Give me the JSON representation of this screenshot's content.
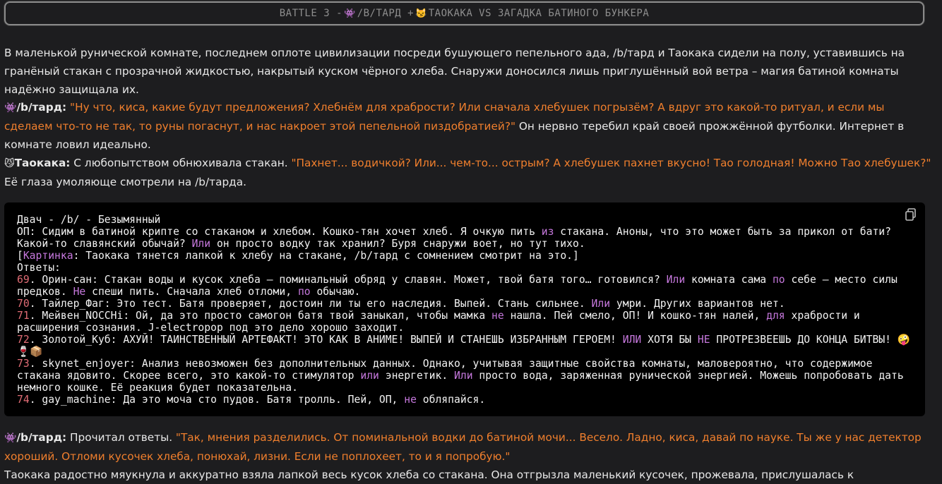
{
  "title": {
    "part1": "BATTLE 3 - ",
    "emoji1": "👾",
    "part2": "/B/ТАРД + ",
    "emoji2": "😼",
    "part3": "ТАОКАКА VS ЗАГАДКА БАТИНОГО БУНКЕРА"
  },
  "intro": "В маленькой рунической комнате, последнем оплоте цивилизации посреди бушующего пепельного ада, /b/тард и Таокака сидели на полу, уставившись на гранёный стакан с прозрачной жидкостью, накрытый куском чёрного хлеба. Снаружи доносился лишь приглушённый вой ветра – магия батиной комнаты надёжно защищала их.",
  "dialog1": {
    "emoji": "👾",
    "speaker": "/b/тард:",
    "quote": "\"Ну что, киса, какие будут предложения? Хлебнём для храбрости? Или сначала хлебушек погрызём? А вдруг это какой-то ритуал, и если мы сделаем что-то не так, то руны погаснут, и нас накроет этой пепельной пиздобратией?\"",
    "after": " Он нервно теребил край своей прожжённой футболки. Интернет в комнате ловил идеально."
  },
  "dialog2": {
    "emoji": "😼",
    "speaker": "Таокака:",
    "before": " С любопытством обнюхивала стакан. ",
    "quote": "\"Пахнет... водичкой? Или... чем-то... острым? А хлебушек пахнет вкусно! Тао голодная! Можно Тао хлебушек?\"",
    "after": " Её глаза умоляюще смотрели на /b/тарда."
  },
  "code": {
    "header": "Двач - /b/ - Безымянный",
    "op_a": "ОП: Сидим в батиной крипте со стаканом и хлебом. Кошко-тян хочет хлеб. Я очкую пить ",
    "op_kw1": "из",
    "op_b": " стакана. Аноны, что это может быть за прикол от бати? Какой-то славянский обычай? ",
    "op_kw2": "Или",
    "op_c": " он просто водку так хранил? Буря снаружи воет, но тут тихо.",
    "pic_open": "[",
    "pic_kw": "Картинка",
    "pic_text": ": Таокака тянется лапкой к хлебу на стакане, /b/тард с сомнением смотрит на это.]",
    "answers": "Ответы:",
    "r69_num": "69",
    "r69_a": ". Орин-сан: Стакан воды и кусок хлеба – поминальный обряд у славян. Может, твой батя того… готовился? ",
    "r69_kw1": "Или",
    "r69_b": " комната сама ",
    "r69_kw2": "по",
    "r69_c": " себе – место силы предков. ",
    "r69_kw3": "Не",
    "r69_d": " спеши пить. Сначала хлеб отломи, ",
    "r69_kw4": "по",
    "r69_e": " обычаю.",
    "r70_num": "70",
    "r70_a": ". Тайлер_Фаг: Это тест. Батя проверяет, достоин ли ты его наследия. Выпей. Стань сильнее. ",
    "r70_kw1": "Или",
    "r70_b": " умри. Других вариантов нет.",
    "r71_num": "71",
    "r71_a": ". Мейвен_NOCCHi: Ой, да это просто самогон батя твой заныкал, чтобы мамка ",
    "r71_kw1": "не",
    "r71_b": " нашла. Пей смело, ОП! И кошко-тян налей, ",
    "r71_kw2": "для",
    "r71_c": " храбрости и расширения сознания. J-electropop под это дело хорошо заходит.",
    "r72_num": "72",
    "r72_a": ". Золотой_Куб: АХУЙ! ТАИНСТВЕННЫЙ АРТЕФАКТ! ЭТО КАК В АНИМЕ! ВЫПЕЙ И СТАНЕШЬ ИЗБРАННЫМ ГЕРОЕМ! ",
    "r72_kw1": "ИЛИ",
    "r72_b": " ХОТЯ БЫ ",
    "r72_kw2": "НЕ",
    "r72_c": " ПРОТРЕЗВЕЕШЬ ДО КОНЦА БИТВЫ! ",
    "r72_emoji": "🤪🍷📦",
    "r73_num": "73",
    "r73_a": ". skynet_enjoyer: Анализ невозможен без дополнительных данных. Однако, учитывая защитные свойства комнаты, маловероятно, что содержимое стакана ядовито. Скорее всего, это какой-то стимулятор ",
    "r73_kw1": "или",
    "r73_b": " энергетик. ",
    "r73_kw2": "Или",
    "r73_c": " просто вода, заряженная рунической энергией. Можешь попробовать дать немного кошке. Её реакция будет показательна.",
    "r74_num": "74",
    "r74_a": ". gay_machine: Да это моча сто пудов. Батя тролль. Пей, ОП, ",
    "r74_kw1": "не",
    "r74_b": " обляпайся."
  },
  "dialog3": {
    "emoji": "👾",
    "speaker": "/b/тард:",
    "before": " Прочитал ответы. ",
    "quote": "\"Так, мнения разделились. От поминальной водки до батиной мочи... Весело. Ладно, киса, давай по науке. Ты же у нас детектор хороший. Отломи кусочек хлеба, понюхай, лизни. Если не поплохеет, то и я попробую.\""
  },
  "cutoff": "Таокака радостно мяукнула и аккуратно взяла лапкой весь кусок хлеба со стакана. Она отгрызла маленький кусочек, прожевала, прислушалась к"
}
